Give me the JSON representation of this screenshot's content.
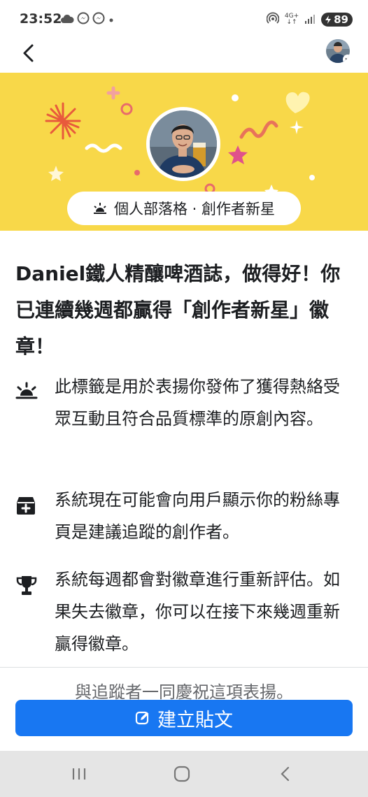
{
  "status": {
    "time": "23:52",
    "network": "4G+",
    "battery": "89"
  },
  "banner": {
    "pill_text": "個人部落格 · 創作者新星"
  },
  "main": {
    "title": "Daniel鐵人精釀啤酒誌，做得好！你已連續幾週都贏得「創作者新星」徽章！",
    "items": [
      {
        "icon": "sunrise-icon",
        "text": "此標籤是用於表揚你發佈了獲得熱絡受眾互動且符合品質標準的原創內容。"
      },
      {
        "icon": "inbox-plus-icon",
        "text": "系統現在可能會向用戶顯示你的粉絲專頁是建議追蹤的創作者。"
      },
      {
        "icon": "trophy-icon",
        "text": "系統每週都會對徽章進行重新評估。如果失去徽章，你可以在接下來幾週重新贏得徽章。"
      }
    ],
    "celebrate_text": "與追蹤者一同慶祝這項表揚。"
  },
  "cta": {
    "label": "建立貼文"
  },
  "colors": {
    "banner": "#f8d849",
    "accent": "#1877f2",
    "text": "#1c1e21"
  }
}
